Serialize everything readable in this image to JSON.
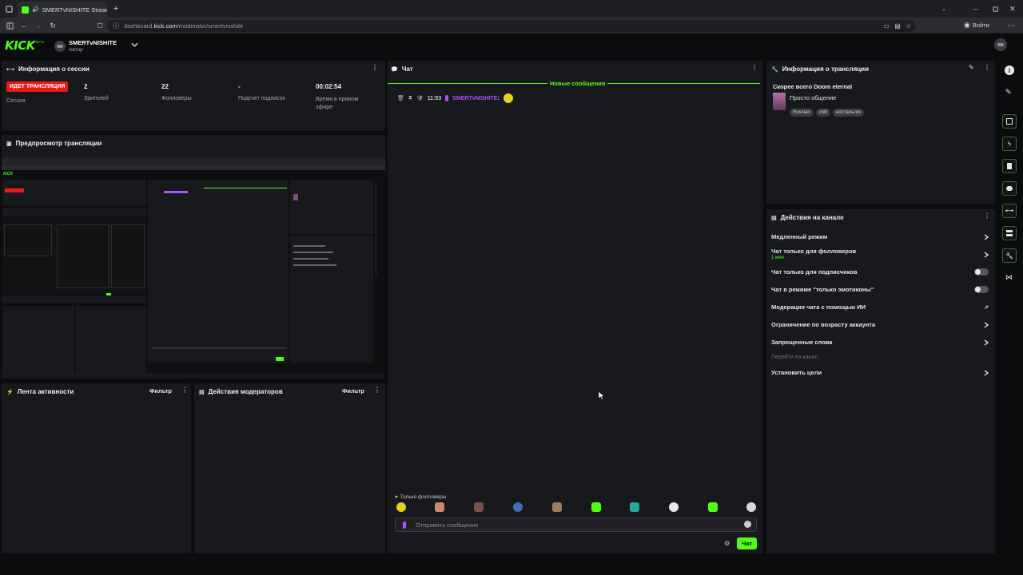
{
  "browser": {
    "tab_title": "SMERTvNISHITE Stream - K",
    "url_prefix": "dashboard.",
    "url_domain": "kick.com",
    "url_path": "/moderator/smertvnishite",
    "signin_label": "Войти"
  },
  "header": {
    "logo": "KICK",
    "logo_badge": "BETA",
    "channel_name": "SMERTvNISHITE",
    "role": "Автор"
  },
  "session": {
    "title": "Информация о сессии",
    "live_badge": "ИДЕТ ТРАНСЛЯЦИЯ",
    "live_label": "Сессия",
    "viewers_value": "2",
    "viewers_label": "Зрителей",
    "followers_value": "22",
    "followers_label": "Фолловеры",
    "subs_value": "-",
    "subs_label": "Подсчет подписок",
    "time_value": "00:02:54",
    "time_label": "Время в прямом эфире"
  },
  "preview": {
    "title": "Предпросмотр трансляции"
  },
  "activity": {
    "title": "Лента активности",
    "filter": "Фильтр"
  },
  "mod_actions": {
    "title": "Действия модераторов",
    "filter": "Фильтр"
  },
  "chat": {
    "title": "Чат",
    "new_messages": "Новые сообщения",
    "message": {
      "time": "11:53",
      "user": "SMERTvNISHITE",
      "separator": ":"
    },
    "followers_only": "Только фолловеры",
    "input_placeholder": "Отправить сообщение",
    "send_label": "Чат"
  },
  "stream_info": {
    "title": "Информация о трансляции",
    "stream_title": "Скорее всего Doom eternal",
    "category": "Просто общение",
    "tags": [
      "Russian",
      "chill",
      "ностальгия"
    ]
  },
  "channel_actions": {
    "title": "Действия на канале",
    "slow_mode": "Медленный режим",
    "followers_chat": "Чат только для фолловеров",
    "followers_chat_sub": "1 мин",
    "subs_chat": "Чат только для подписчиков",
    "emote_chat": "Чат в режиме \"только эмотиконы\"",
    "ai_moderation": "Модерация чата с помощью ИИ",
    "age_restriction": "Ограничение по возрасту аккаунта",
    "banned_words": "Запрещенные слова",
    "goto_channel": "Перейти на канал",
    "set_goals": "Установить цели"
  },
  "colors": {
    "accent": "#53fc18",
    "live": "#e91916",
    "username": "#b34dff"
  }
}
